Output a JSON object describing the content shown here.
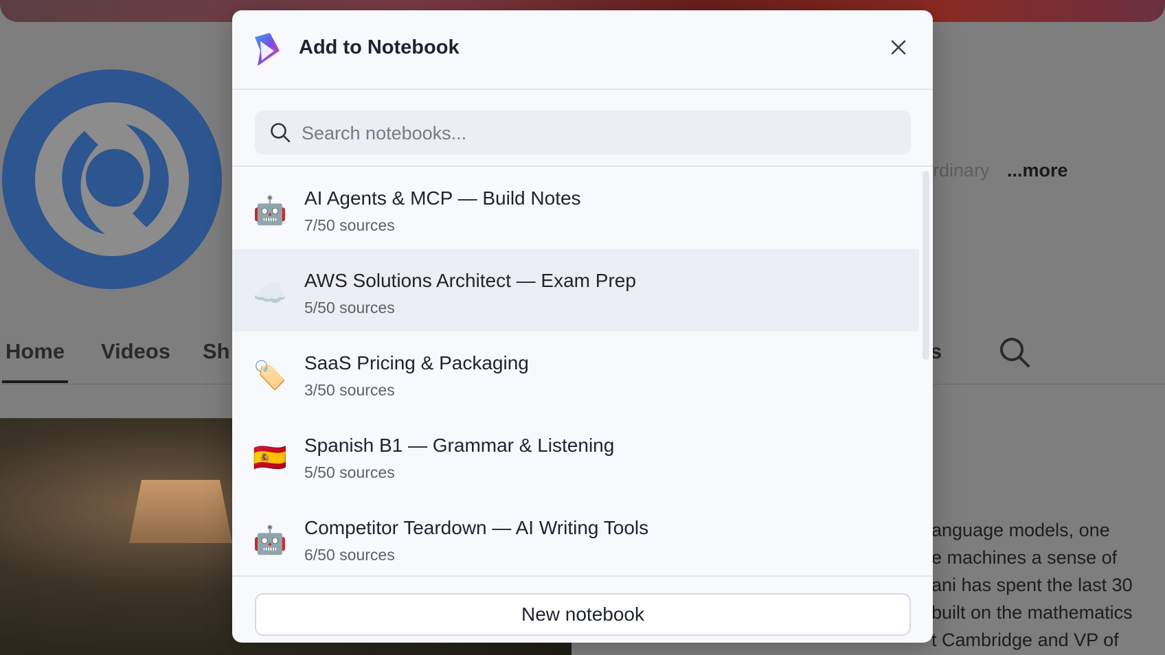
{
  "background_page": {
    "tabs": [
      "Home",
      "Videos",
      "Sh"
    ],
    "tab_fragment": "s",
    "description_fragment": "rdinary",
    "more_label": "...more",
    "video_text_lines": [
      "anguage models, one",
      "e machines a sense of",
      "ani has spent the last 30",
      "built on the mathematics",
      "t Cambridge and VP of"
    ]
  },
  "modal": {
    "title": "Add to Notebook",
    "search": {
      "placeholder": "Search notebooks..."
    },
    "notebooks": [
      {
        "emoji": "🤖",
        "emoji_name": "robot-icon",
        "title": "AI Agents & MCP — Build Notes",
        "sources": "7/50 sources"
      },
      {
        "emoji": "☁️",
        "emoji_name": "cloud-icon",
        "title": "AWS Solutions Architect — Exam Prep",
        "sources": "5/50 sources"
      },
      {
        "emoji": "🏷️",
        "emoji_name": "tag-icon",
        "title": "SaaS Pricing & Packaging",
        "sources": "3/50 sources"
      },
      {
        "emoji": "🇪🇸",
        "emoji_name": "spain-flag-icon",
        "title": "Spanish B1 — Grammar & Listening",
        "sources": "5/50 sources"
      },
      {
        "emoji": "🤖",
        "emoji_name": "robot-icon",
        "title": "Competitor Teardown — AI Writing Tools",
        "sources": "6/50 sources"
      }
    ],
    "hovered_index": 1,
    "new_notebook_label": "New notebook"
  },
  "icons": {
    "logo": "notebook-logo-icon",
    "close": "close-icon",
    "search": "search-icon"
  },
  "colors": {
    "overlay": "#7e7e7e",
    "modal_bg": "#f8f9fc",
    "hover_row": "#eceef5",
    "avatar_blue": "#2d5590"
  }
}
